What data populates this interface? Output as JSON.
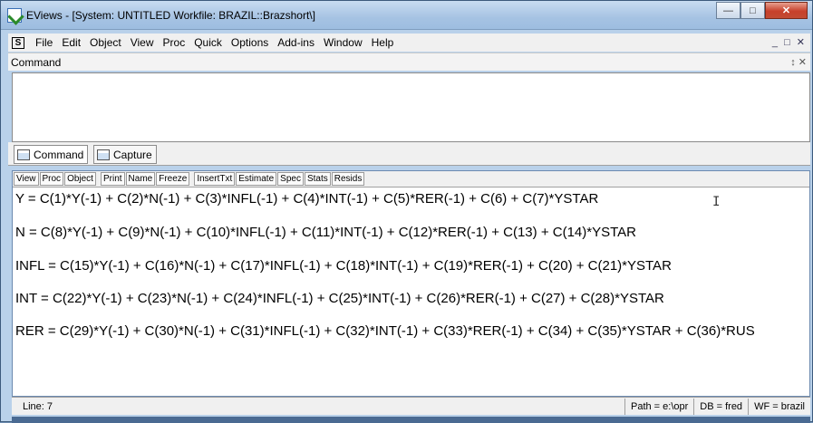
{
  "window": {
    "title": "EViews - [System: UNTITLED   Workfile: BRAZIL::Brazshort\\]"
  },
  "menubar": {
    "items": [
      "File",
      "Edit",
      "Object",
      "View",
      "Proc",
      "Quick",
      "Options",
      "Add-ins",
      "Window",
      "Help"
    ]
  },
  "command_pane": {
    "title": "Command",
    "tabs": [
      "Command",
      "Capture"
    ]
  },
  "toolbar": {
    "buttons": [
      "View",
      "Proc",
      "Object",
      "Print",
      "Name",
      "Freeze",
      "InsertTxt",
      "Estimate",
      "Spec",
      "Stats",
      "Resids"
    ]
  },
  "equations": [
    "Y = C(1)*Y(-1) + C(2)*N(-1) + C(3)*INFL(-1) + C(4)*INT(-1) + C(5)*RER(-1) + C(6) + C(7)*YSTAR",
    "N = C(8)*Y(-1) + C(9)*N(-1) + C(10)*INFL(-1) + C(11)*INT(-1) + C(12)*RER(-1) + C(13) + C(14)*YSTAR",
    "INFL = C(15)*Y(-1) + C(16)*N(-1) + C(17)*INFL(-1) + C(18)*INT(-1) + C(19)*RER(-1) + C(20) + C(21)*YSTAR",
    "INT = C(22)*Y(-1) + C(23)*N(-1) + C(24)*INFL(-1) + C(25)*INT(-1) + C(26)*RER(-1) + C(27) + C(28)*YSTAR",
    "RER = C(29)*Y(-1) + C(30)*N(-1) + C(31)*INFL(-1) + C(32)*INT(-1) + C(33)*RER(-1) + C(34) + C(35)*YSTAR + C(36)*RUS"
  ],
  "statusbar": {
    "line": "Line: 7",
    "path": "Path = e:\\opr",
    "db": "DB = fred",
    "wf": "WF = brazil"
  },
  "icons": [
    "eviews-app-icon",
    "minimize-icon",
    "maximize-icon",
    "close-icon",
    "pin-icon",
    "text-cursor-icon"
  ]
}
